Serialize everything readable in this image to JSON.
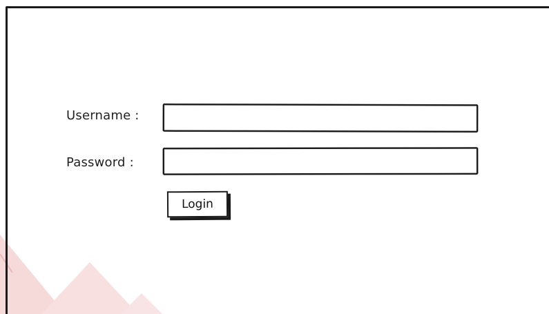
{
  "form": {
    "username_label": "Username :",
    "username_value": "",
    "password_label": "Password :",
    "password_value": "",
    "login_label": "Login"
  },
  "colors": {
    "stroke": "#1a1a1a",
    "background": "#ffffff",
    "watermark": "#f6d3d3"
  }
}
